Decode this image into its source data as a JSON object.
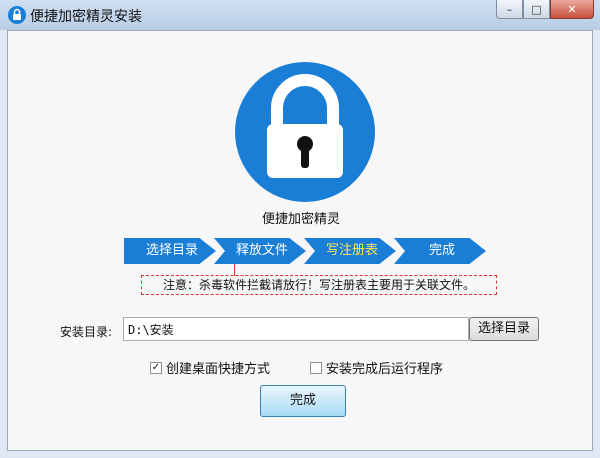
{
  "window": {
    "title": "便捷加密精灵安装",
    "minimize_glyph": "–",
    "maximize_glyph": "□",
    "close_glyph": "✕"
  },
  "app": {
    "name": "便捷加密精灵",
    "logo_icon": "lock-icon",
    "accent": "#1a7ed6"
  },
  "steps": [
    {
      "label": "选择目录",
      "active": false
    },
    {
      "label": "释放文件",
      "active": false
    },
    {
      "label": "写注册表",
      "active": true
    },
    {
      "label": "完成",
      "active": false
    }
  ],
  "notice": "注意：杀毒软件拦截请放行！写注册表主要用于关联文件。",
  "install": {
    "label": "安装目录:",
    "path": "D:\\安装",
    "browse_label": "选择目录"
  },
  "options": [
    {
      "label": "创建桌面快捷方式",
      "checked": true
    },
    {
      "label": "安装完成后运行程序",
      "checked": false
    }
  ],
  "finish_label": "完成"
}
